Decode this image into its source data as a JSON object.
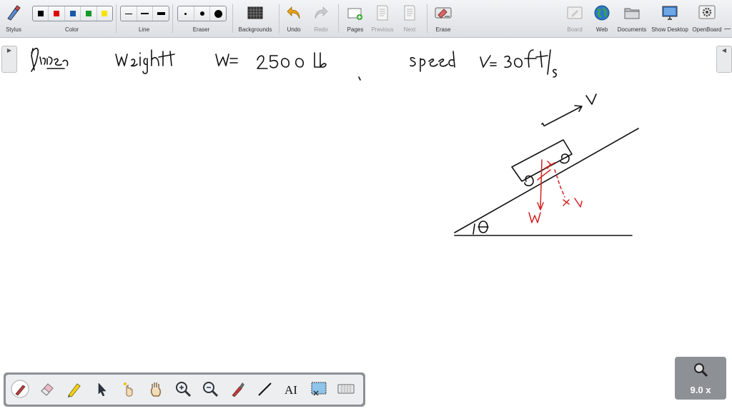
{
  "toolbar": {
    "stylus": "Stylus",
    "color": "Color",
    "line": "Line",
    "eraser": "Eraser",
    "backgrounds": "Backgrounds",
    "undo": "Undo",
    "redo": "Redo",
    "pages": "Pages",
    "previous": "Previous",
    "next": "Next",
    "erase": "Erase",
    "board": "Board",
    "web": "Web",
    "documents": "Documents",
    "show_desktop": "Show Desktop",
    "openboard": "OpenBoard"
  },
  "colors": {
    "swatches": [
      "#000000",
      "#e00000",
      "#1a5aa8",
      "#139a2a",
      "#f5e400"
    ],
    "ink_black": "#111111",
    "ink_red": "#d42020"
  },
  "side": {
    "left_arrow": "▶",
    "right_arrow": "◀"
  },
  "zoom": {
    "value": "9.0 x"
  },
  "bottom_tools": [
    "pen-icon",
    "eraser-icon",
    "highlighter-icon",
    "pointer-icon",
    "laser-icon",
    "hand-icon",
    "zoom-in-icon",
    "zoom-out-icon",
    "capture-icon",
    "line-icon",
    "text-icon",
    "screenshot-icon",
    "keyboard-icon"
  ]
}
